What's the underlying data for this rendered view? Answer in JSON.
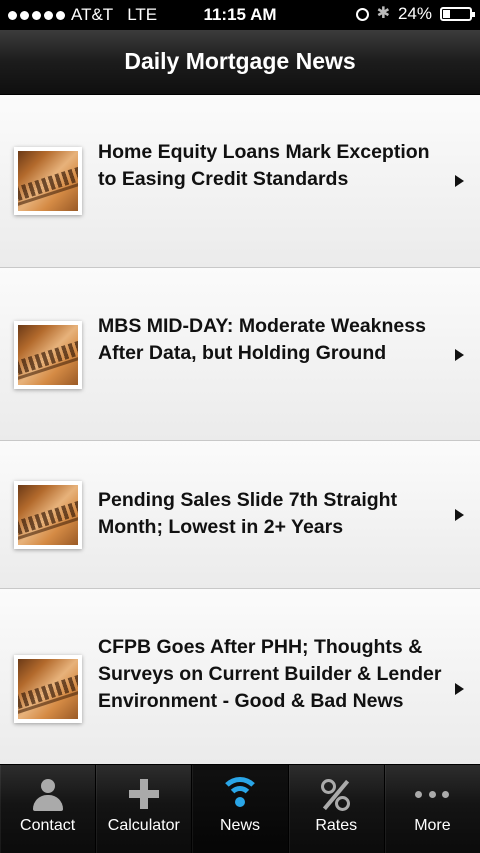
{
  "status_bar": {
    "carrier": "AT&T",
    "network": "LTE",
    "time": "11:15 AM",
    "battery": "24%",
    "battery_level": 0.24
  },
  "nav": {
    "title": "Daily Mortgage News"
  },
  "articles": [
    {
      "title": "Home Equity Loans Mark Exception to Easing Credit Standards"
    },
    {
      "title": "MBS MID-DAY: Moderate Weakness After Data, but Holding Ground"
    },
    {
      "title": "Pending Sales Slide 7th Straight Month; Lowest in 2+ Years"
    },
    {
      "title": "CFPB Goes After PHH; Thoughts & Surveys on Current Builder & Lender Environment - Good & Bad News"
    }
  ],
  "tabs": [
    {
      "label": "Contact",
      "icon": "contact-icon"
    },
    {
      "label": "Calculator",
      "icon": "plus-icon"
    },
    {
      "label": "News",
      "icon": "wifi-icon",
      "active": true
    },
    {
      "label": "Rates",
      "icon": "percent-icon"
    },
    {
      "label": "More",
      "icon": "more-icon"
    }
  ],
  "colors": {
    "accent": "#2aa6e8",
    "tab_icon_inactive": "#aaaaaa"
  }
}
